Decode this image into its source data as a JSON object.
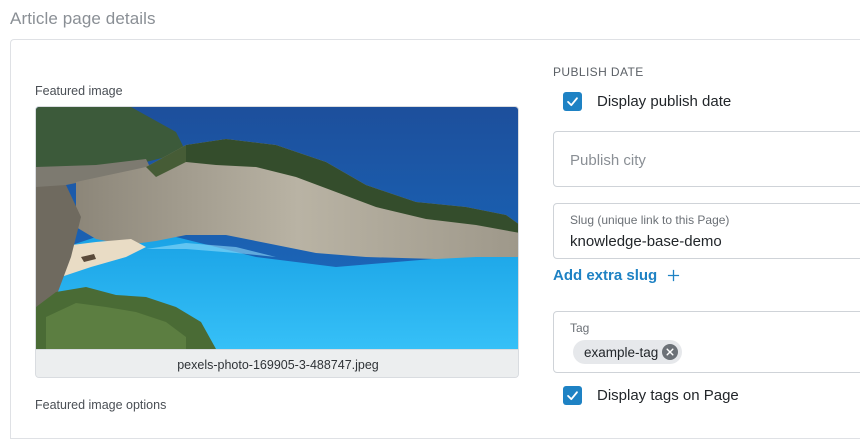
{
  "page": {
    "title": "Article page details"
  },
  "featured_image": {
    "label": "Featured image",
    "filename": "pexels-photo-169905-3-488747.jpeg",
    "options_label": "Featured image options"
  },
  "publish": {
    "heading": "PUBLISH DATE",
    "display_publish_date": {
      "label": "Display publish date",
      "checked": true
    },
    "city": {
      "placeholder": "Publish city",
      "value": ""
    }
  },
  "slug": {
    "caption": "Slug (unique link to this Page)",
    "value": "knowledge-base-demo",
    "add_label": "Add extra slug"
  },
  "tags": {
    "caption": "Tag",
    "items": [
      {
        "label": "example-tag"
      }
    ],
    "display_on_page": {
      "label": "Display tags on Page",
      "checked": true
    }
  },
  "colors": {
    "accent": "#1e82c4",
    "border": "#cfd3d8",
    "chip": "#e6e8eb"
  },
  "icons": {
    "check": "check-icon",
    "plus": "plus-icon",
    "remove": "close-circle-icon"
  }
}
